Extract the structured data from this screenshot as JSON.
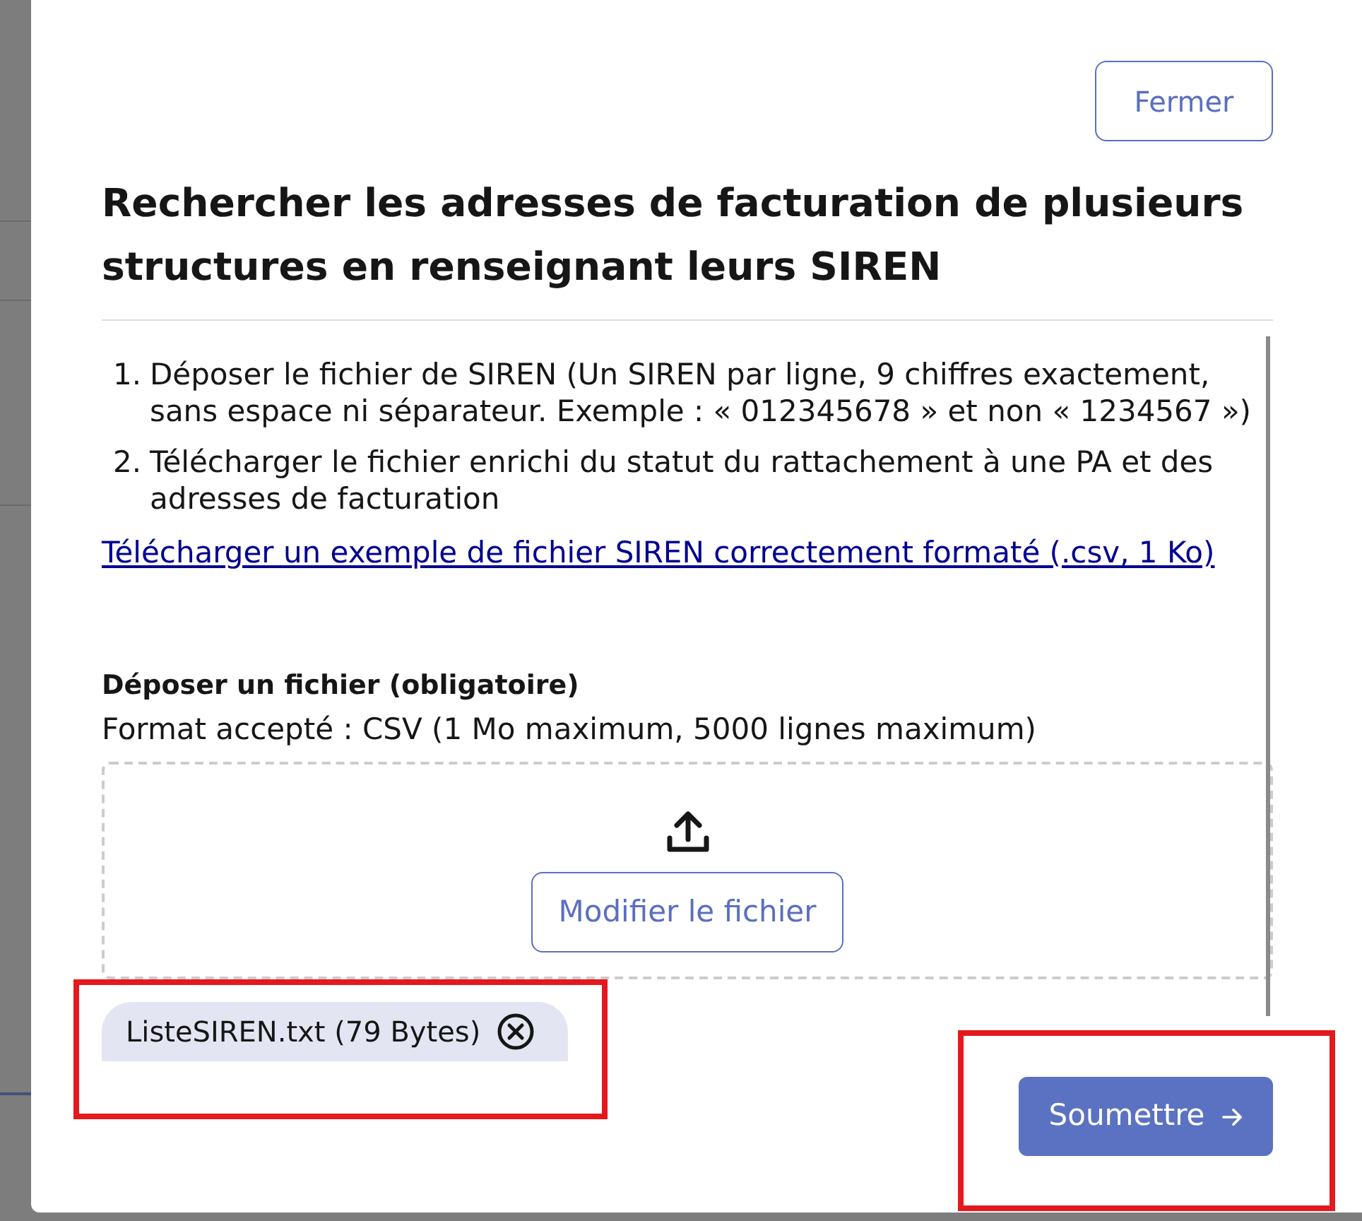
{
  "dialog": {
    "close_button": "Fermer",
    "title": "Rechercher les adresses de facturation de plusieurs structures en renseignant leurs SIREN",
    "steps": [
      {
        "number": "1.",
        "text": "Déposer le fichier de SIREN (Un SIREN par ligne, 9 chiffres exactement, sans espace ni séparateur. Exemple : « 012345678 » et non « 1234567 »)"
      },
      {
        "number": "2.",
        "text": "Télécharger le fichier enrichi du statut du rattachement à une PA et des adresses de facturation"
      }
    ],
    "example_link": "Télécharger un exemple de fichier SIREN correctement formaté (.csv, 1 Ko)",
    "upload": {
      "label": "Déposer un fichier (obligatoire)",
      "hint": "Format accepté : CSV (1 Mo maximum, 5000 lignes maximum)",
      "change_button": "Modifier le fichier"
    },
    "file_chip": {
      "text": "ListeSIREN.txt (79 Bytes)",
      "highlighted": true
    },
    "submit_button": {
      "label": "Soumettre",
      "highlighted": true
    }
  }
}
